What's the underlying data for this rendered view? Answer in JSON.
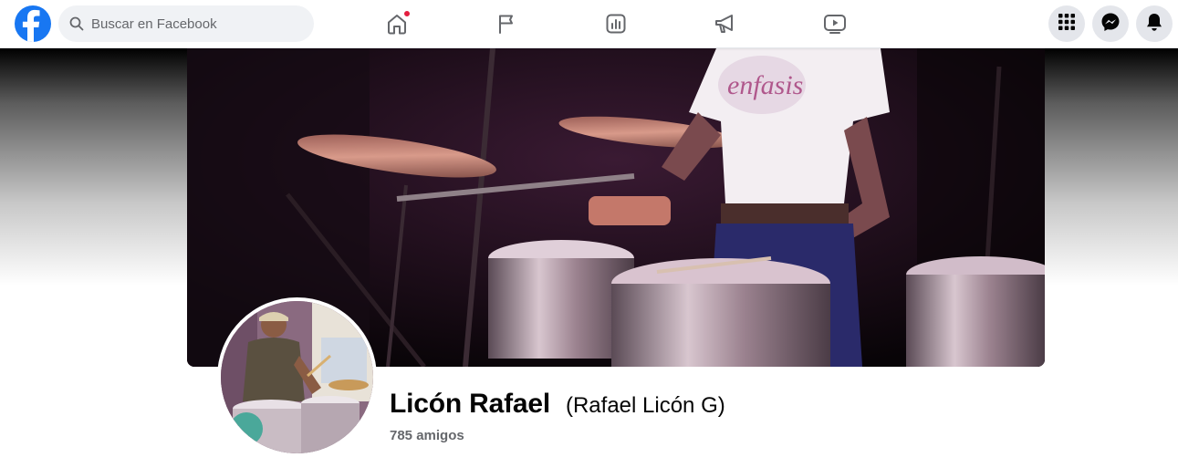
{
  "topbar": {
    "logo_icon": "facebook-logo",
    "search": {
      "placeholder": "Buscar en Facebook",
      "value": "",
      "icon": "search-icon"
    },
    "nav_tabs": [
      {
        "name": "home",
        "icon": "home-icon",
        "has_notification": true
      },
      {
        "name": "pages",
        "icon": "flag-icon",
        "has_notification": false
      },
      {
        "name": "dashboard",
        "icon": "chart-icon",
        "has_notification": false
      },
      {
        "name": "ads",
        "icon": "megaphone-icon",
        "has_notification": false
      },
      {
        "name": "watch",
        "icon": "video-icon",
        "has_notification": false
      }
    ],
    "right_buttons": [
      {
        "name": "menu",
        "icon": "grid-icon"
      },
      {
        "name": "messenger",
        "icon": "messenger-icon"
      },
      {
        "name": "notifications",
        "icon": "bell-icon"
      }
    ]
  },
  "profile": {
    "name": "Licón Rafael",
    "alternate_name": "(Rafael Licón G)",
    "friends_count": "785 amigos"
  },
  "colors": {
    "brand": "#1877f2",
    "notification": "#e41e3f",
    "text_primary": "#050505",
    "text_secondary": "#65676b",
    "button_bg": "#e4e6eb",
    "search_bg": "#f0f2f5"
  }
}
